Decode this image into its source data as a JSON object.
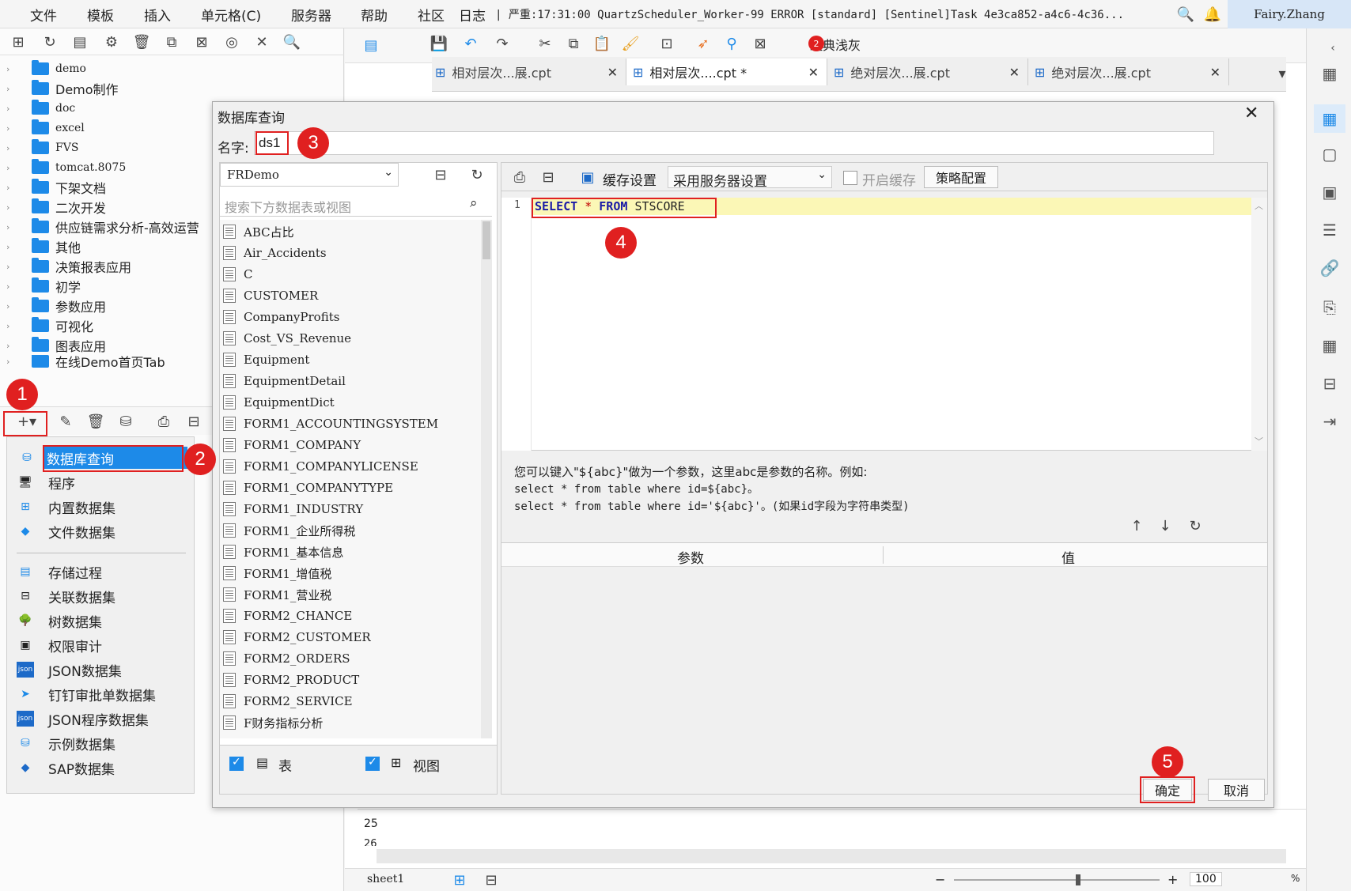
{
  "menubar": {
    "items": [
      "文件",
      "模板",
      "插入",
      "单元格(C)",
      "服务器",
      "帮助",
      "社区",
      "日志"
    ],
    "log_text": "| 严重:17:31:00 QuartzScheduler_Worker-99 ERROR [standard] [Sentinel]Task 4e3ca852-a4c6-4c36...",
    "user": "Fairy.Zhang"
  },
  "tree": {
    "items": [
      "demo",
      "Demo制作",
      "doc",
      "excel",
      "FVS",
      "tomcat.8075",
      "下架文档",
      "二次开发",
      "供应链需求分析-高效运营",
      "其他",
      "决策报表应用",
      "初学",
      "参数应用",
      "可视化",
      "图表应用",
      "在线Demo首页Tab"
    ]
  },
  "dataset_menu": {
    "items": [
      "数据库查询",
      "程序",
      "内置数据集",
      "文件数据集",
      "存储过程",
      "关联数据集",
      "树数据集",
      "权限审计",
      "JSON数据集",
      "钉钉审批单数据集",
      "JSON程序数据集",
      "示例数据集",
      "SAP数据集"
    ]
  },
  "toolbar": {
    "theme_label": "经典浅灰",
    "notification_count": "2"
  },
  "tabs": [
    {
      "label": "相对层次...展.cpt"
    },
    {
      "label": "相对层次....cpt *"
    },
    {
      "label": "绝对层次...展.cpt"
    },
    {
      "label": "绝对层次...展.cpt"
    }
  ],
  "dialog": {
    "title": "数据库查询",
    "name_label": "名字:",
    "name_value": "ds1",
    "connection": "FRDemo",
    "search_placeholder": "搜索下方数据表或视图",
    "tables": [
      "ABC占比",
      "Air_Accidents",
      "C",
      "CUSTOMER",
      "CompanyProfits",
      "Cost_VS_Revenue",
      "Equipment",
      "EquipmentDetail",
      "EquipmentDict",
      "FORM1_ACCOUNTINGSYSTEM",
      "FORM1_COMPANY",
      "FORM1_COMPANYLICENSE",
      "FORM1_COMPANYTYPE",
      "FORM1_INDUSTRY",
      "FORM1_企业所得税",
      "FORM1_基本信息",
      "FORM1_增值税",
      "FORM1_营业税",
      "FORM2_CHANCE",
      "FORM2_CUSTOMER",
      "FORM2_ORDERS",
      "FORM2_PRODUCT",
      "FORM2_SERVICE",
      "F财务指标分析"
    ],
    "table_checkbox_label": "表",
    "view_checkbox_label": "视图",
    "cache_label": "缓存设置",
    "cache_option": "采用服务器设置",
    "enable_cache_label": "开启缓存",
    "strategy_label": "策略配置",
    "sql_line_number": "1",
    "sql_keyword_select": "SELECT",
    "sql_star": "*",
    "sql_keyword_from": "FROM",
    "sql_table": "STSCORE",
    "hint_line1": "您可以键入\"${abc}\"做为一个参数，这里abc是参数的名称。例如:",
    "hint_line2": "select * from table where id=${abc}。",
    "hint_line3": "select * from table where id='${abc}'。(如果id字段为字符串类型)",
    "param_col": "参数",
    "value_col": "值",
    "ok_label": "确定",
    "cancel_label": "取消"
  },
  "badges": [
    "1",
    "2",
    "3",
    "4",
    "5"
  ],
  "sheet": {
    "row_25": "25",
    "row_26": "26",
    "tab_name": "sheet1",
    "zoom": "100",
    "zoom_unit": "%"
  }
}
